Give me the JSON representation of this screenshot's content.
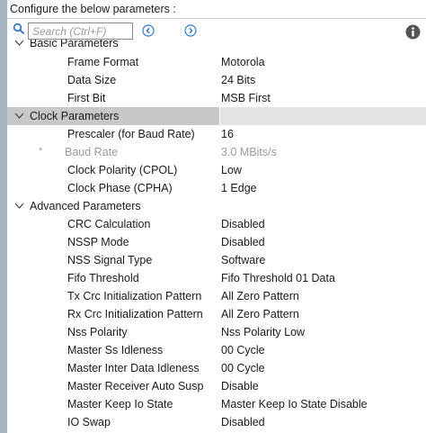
{
  "header": {
    "title": "Configure the below parameters :"
  },
  "search": {
    "placeholder": "Search (Ctrl+F)"
  },
  "groups": [
    {
      "title": "Basic Parameters",
      "params": [
        {
          "name": "Frame Format",
          "value": "Motorola"
        },
        {
          "name": "Data Size",
          "value": "24 Bits"
        },
        {
          "name": "First Bit",
          "value": "MSB First"
        }
      ]
    },
    {
      "title": "Clock Parameters",
      "params": [
        {
          "name": "Prescaler (for Baud Rate)",
          "value": "16"
        },
        {
          "name": "Baud Rate",
          "value": "3.0 MBits/s",
          "marker": "*"
        },
        {
          "name": "Clock Polarity (CPOL)",
          "value": "Low"
        },
        {
          "name": "Clock Phase (CPHA)",
          "value": "1 Edge"
        }
      ]
    },
    {
      "title": "Advanced Parameters",
      "params": [
        {
          "name": "CRC Calculation",
          "value": "Disabled"
        },
        {
          "name": "NSSP Mode",
          "value": "Disabled"
        },
        {
          "name": "NSS Signal Type",
          "value": "Software"
        },
        {
          "name": "Fifo Threshold",
          "value": "Fifo Threshold 01 Data"
        },
        {
          "name": "Tx Crc Initialization Pattern",
          "value": "All Zero Pattern"
        },
        {
          "name": "Rx Crc Initialization Pattern",
          "value": "All Zero Pattern"
        },
        {
          "name": "Nss Polarity",
          "value": "Nss Polarity Low"
        },
        {
          "name": "Master Ss Idleness",
          "value": "00 Cycle"
        },
        {
          "name": "Master Inter Data Idleness",
          "value": "00 Cycle"
        },
        {
          "name": "Master Receiver Auto Susp",
          "value": "Disable"
        },
        {
          "name": "Master Keep Io State",
          "value": "Master Keep Io State Disable"
        },
        {
          "name": "IO Swap",
          "value": "Disabled"
        }
      ]
    }
  ]
}
